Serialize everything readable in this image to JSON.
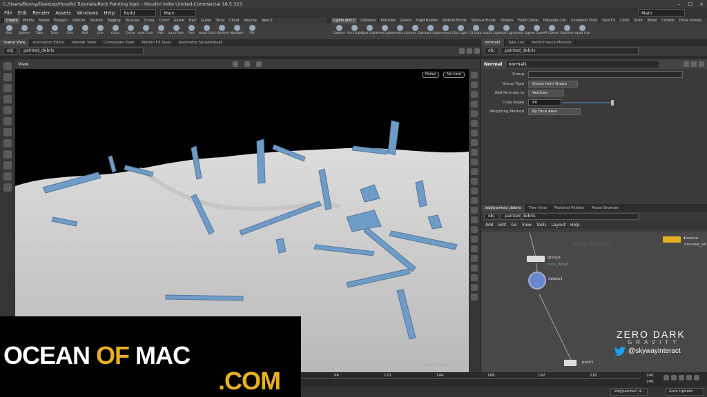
{
  "title": "C:/Users/Bonny/Desktop/Houdini Tutorials/Rock Painting.hiplc - Houdini Indie Limited-Commercial 16.5.323",
  "menu": [
    "File",
    "Edit",
    "Render",
    "Assets",
    "Windows",
    "Help"
  ],
  "build_label": "Build",
  "main_label": "Main",
  "right_main": "Main",
  "shelf_tabs_left": [
    "Create",
    "Modify",
    "Model",
    "Polygon",
    "Deform",
    "Texture",
    "Rigging",
    "Muscles",
    "Chara",
    "Const",
    "Game",
    "Hair",
    "Guide",
    "Terra",
    "Cloud",
    "Volume",
    "New S"
  ],
  "shelf_tools_left": [
    "Box",
    "Sphere",
    "Tube",
    "Torus",
    "Grid",
    "Null",
    "Line",
    "Circle",
    "Curve",
    "Draw Curve",
    "Path",
    "Spray Paint",
    "Font",
    "Platonic Solids",
    "L-System",
    "Metaball",
    "File"
  ],
  "shelf_tabs_right": [
    "Lights and C",
    "Collisions",
    "Particles",
    "Grains",
    "Rigid Bodies",
    "Particle Fluids",
    "Viscous Fluids",
    "Oceans",
    "Fluid Contai",
    "Populate Con",
    "Container Tools",
    "Pyro FX",
    "Cloth",
    "Solid",
    "Wires",
    "Crowds",
    "Drive Simula"
  ],
  "shelf_tools_right": [
    "Camera",
    "Point Light",
    "Spot Light",
    "Area Light",
    "Geometry Light",
    "Volume Light",
    "Distant Light",
    "Environment Light",
    "Sky Light",
    "GI Light",
    "Caustic Light",
    "Portal Light",
    "Ambient Light",
    "Stereo Camera",
    "VR Camera",
    "Switcher",
    "Gamepad Camera"
  ],
  "left_tabs": [
    "Scene View",
    "Animation Editor",
    "Render View",
    "Composite View",
    "Motion FX View",
    "Geometry Spreadsheet"
  ],
  "right_tabs": [
    "normal2",
    "Take List",
    "Performance Monitor"
  ],
  "path": {
    "obj": "obj",
    "node": "painted_debris"
  },
  "viewport": {
    "label": "View",
    "persp": "Persp",
    "cam": "No cam",
    "indie": "Indie Edition"
  },
  "node": {
    "type": "Normal",
    "name": "normal1"
  },
  "params": [
    {
      "label": "Group",
      "value": ""
    },
    {
      "label": "Group Type",
      "value": "Guess from Group"
    },
    {
      "label": "Add Normals to",
      "value": "Vertices"
    },
    {
      "label": "Cusp Angle",
      "value": "60"
    },
    {
      "label": "Weighting Method",
      "value": "By Face Area"
    }
  ],
  "net_tabs": [
    "/obj/painted_debris",
    "Tree View",
    "Material Palette",
    "Asset Browser"
  ],
  "net_path": {
    "obj": "obj",
    "node": "painted_debris"
  },
  "net_menu": [
    "Add",
    "Edit",
    "Go",
    "View",
    "Tools",
    "Layout",
    "Help"
  ],
  "net_watermark": "Indie Edition",
  "nodes": {
    "group": "group1",
    "group_sub": "rock_detail",
    "delete": "delete1",
    "dissolve": "dissolve",
    "dissolve_sub": "dissolve_alt",
    "pack": "pack1"
  },
  "timeline": {
    "ticks": [
      "96",
      "120",
      "144",
      "168",
      "192",
      "216"
    ],
    "end1": "240",
    "end2": "240"
  },
  "status": {
    "path": "/obj/painted_d...",
    "update": "Auto Update"
  },
  "watermark": {
    "line1a": "OCEAN ",
    "line1b": "OF",
    "line1c": " MAC",
    "line2": ".COM"
  },
  "brand": {
    "zd1": "ZERO DARK",
    "zd2": "GRAVITY",
    "twitter": "@skywayinteract"
  }
}
